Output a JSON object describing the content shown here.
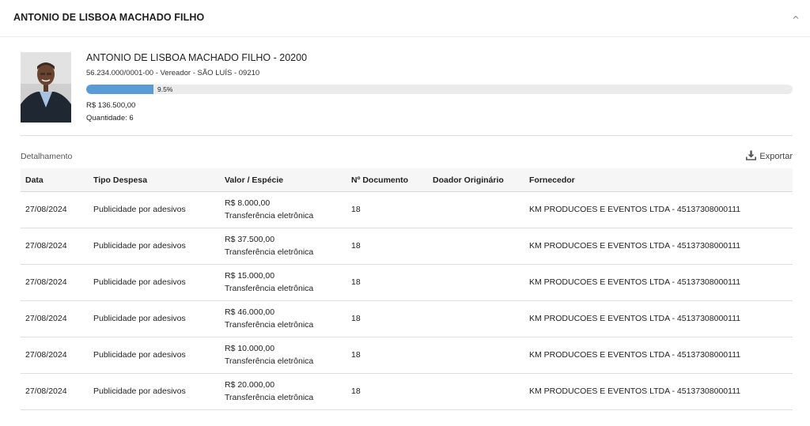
{
  "header": {
    "title": "ANTONIO DE LISBOA MACHADO FILHO",
    "collapse_icon": "chevron-up-icon"
  },
  "candidate": {
    "name": "ANTONIO DE LISBOA MACHADO FILHO - 20200",
    "subtitle": "56.234.000/0001-00 - Vereador - SÃO LUÍS - 09210",
    "progress_label": "9.5%",
    "progress_fraction": 0.095,
    "total": "R$ 136.500,00",
    "quantity": "Quantidade: 6"
  },
  "details": {
    "section_label": "Detalhamento",
    "export_label": "Exportar",
    "export_icon": "download-icon",
    "columns": [
      "Data",
      "Tipo Despesa",
      "Valor / Espécie",
      "Nº Documento",
      "Doador Originário",
      "Fornecedor"
    ],
    "rows": [
      {
        "data": "27/08/2024",
        "tipo": "Publicidade por adesivos",
        "valor": "R$ 8.000,00",
        "especie": "Transferência eletrônica",
        "documento": "18",
        "doador": "",
        "fornecedor": "KM PRODUCOES E EVENTOS LTDA - 45137308000111"
      },
      {
        "data": "27/08/2024",
        "tipo": "Publicidade por adesivos",
        "valor": "R$ 37.500,00",
        "especie": "Transferência eletrônica",
        "documento": "18",
        "doador": "",
        "fornecedor": "KM PRODUCOES E EVENTOS LTDA - 45137308000111"
      },
      {
        "data": "27/08/2024",
        "tipo": "Publicidade por adesivos",
        "valor": "R$ 15.000,00",
        "especie": "Transferência eletrônica",
        "documento": "18",
        "doador": "",
        "fornecedor": "KM PRODUCOES E EVENTOS LTDA - 45137308000111"
      },
      {
        "data": "27/08/2024",
        "tipo": "Publicidade por adesivos",
        "valor": "R$ 46.000,00",
        "especie": "Transferência eletrônica",
        "documento": "18",
        "doador": "",
        "fornecedor": "KM PRODUCOES E EVENTOS LTDA - 45137308000111"
      },
      {
        "data": "27/08/2024",
        "tipo": "Publicidade por adesivos",
        "valor": "R$ 10.000,00",
        "especie": "Transferência eletrônica",
        "documento": "18",
        "doador": "",
        "fornecedor": "KM PRODUCOES E EVENTOS LTDA - 45137308000111"
      },
      {
        "data": "27/08/2024",
        "tipo": "Publicidade por adesivos",
        "valor": "R$ 20.000,00",
        "especie": "Transferência eletrônica",
        "documento": "18",
        "doador": "",
        "fornecedor": "KM PRODUCOES E EVENTOS LTDA - 45137308000111"
      }
    ]
  },
  "colors": {
    "progress_fill": "#5b9bd5",
    "progress_track": "#ebebeb"
  }
}
